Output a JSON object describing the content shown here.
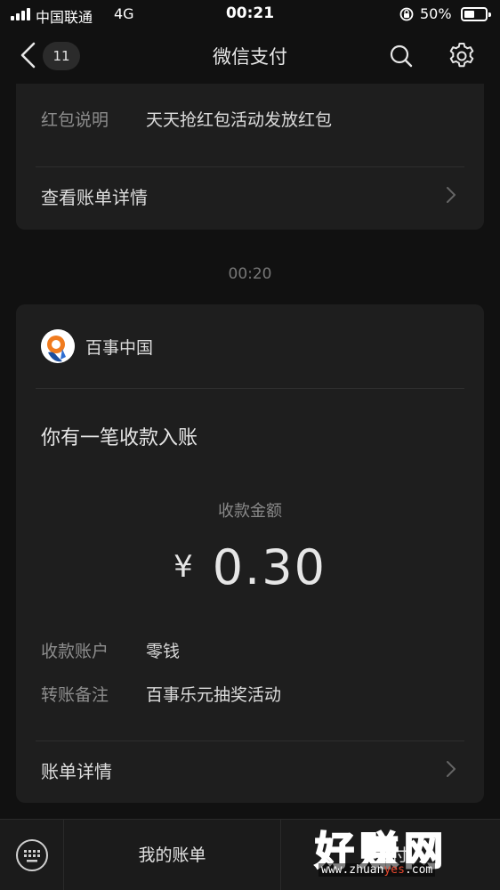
{
  "status_bar": {
    "carrier": "中国联通",
    "network": "4G",
    "time": "00:21",
    "battery_percent": "50%",
    "battery_level": 0.5
  },
  "nav": {
    "back_count": "11",
    "title": "微信支付",
    "icons": [
      "chevron-left-icon",
      "search-icon",
      "gear-icon"
    ]
  },
  "previous_message": {
    "rows": [
      {
        "label": "红包说明",
        "value": "天天抢红包活动发放红包"
      }
    ],
    "detail_link": "查看账单详情"
  },
  "timestamp": "00:20",
  "message": {
    "merchant": "百事中国",
    "headline": "你有一笔收款入账",
    "amount_label": "收款金额",
    "currency": "¥",
    "amount": "0.30",
    "rows": [
      {
        "label": "收款账户",
        "value": "零钱"
      },
      {
        "label": "转账备注",
        "value": "百事乐元抽奖活动"
      }
    ],
    "detail_link": "账单详情"
  },
  "tab_bar": {
    "bills": "我的账单",
    "pay": "支付"
  },
  "watermark": {
    "text": "好赚网",
    "url_prefix": "www.zhuan",
    "url_highlight": "yes",
    "url_suffix": ".com"
  },
  "colors": {
    "background": "#111111",
    "card": "#1e1e1e",
    "label": "#8d8d8d",
    "text": "#dcdcdc"
  }
}
